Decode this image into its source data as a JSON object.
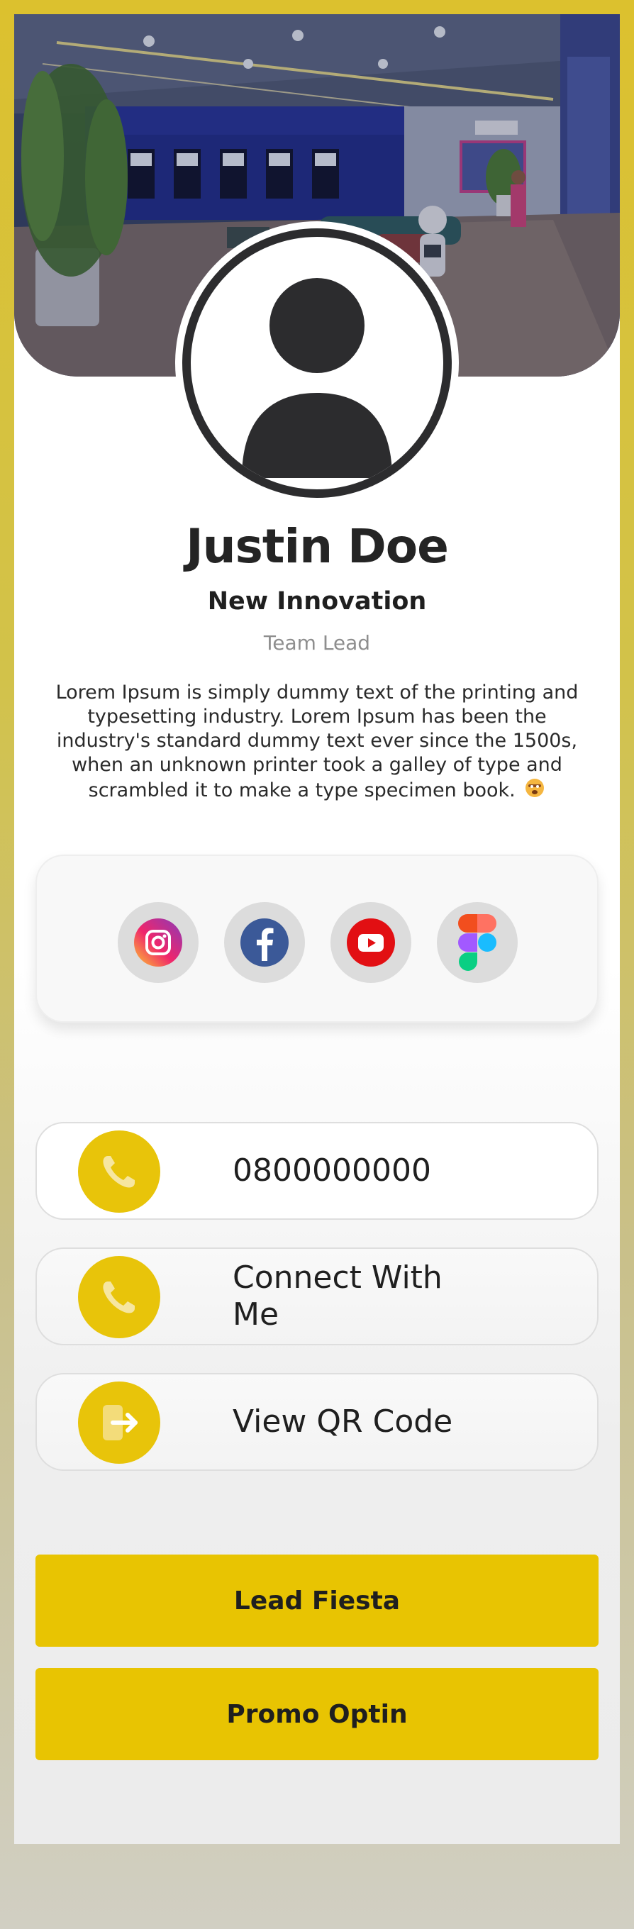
{
  "profile": {
    "name": "Justin Doe",
    "company": "New Innovation",
    "role": "Team Lead",
    "bio": "Lorem Ipsum is simply dummy text of the printing and typesetting industry. Lorem Ipsum has been the industry's standard dummy text ever since the 1500s, when an unknown printer took a galley of type and scrambled it to make a type specimen book.",
    "bio_emoji": "emoji-face-icon"
  },
  "social": [
    {
      "name": "instagram-icon"
    },
    {
      "name": "facebook-icon"
    },
    {
      "name": "youtube-icon"
    },
    {
      "name": "figma-icon"
    }
  ],
  "actions": {
    "phone": {
      "label": "0800000000",
      "icon": "phone-icon"
    },
    "connect": {
      "label": "Connect With Me",
      "icon": "phone-icon"
    },
    "qr": {
      "label": "View QR Code",
      "icon": "exit-arrow-icon"
    }
  },
  "buttons": {
    "lead": "Lead Fiesta",
    "promo": "Promo Optin"
  },
  "colors": {
    "accent": "#e8c402",
    "background_top": "#dcc12e",
    "text_dark": "#242424",
    "text_muted": "#8e8e8e"
  }
}
